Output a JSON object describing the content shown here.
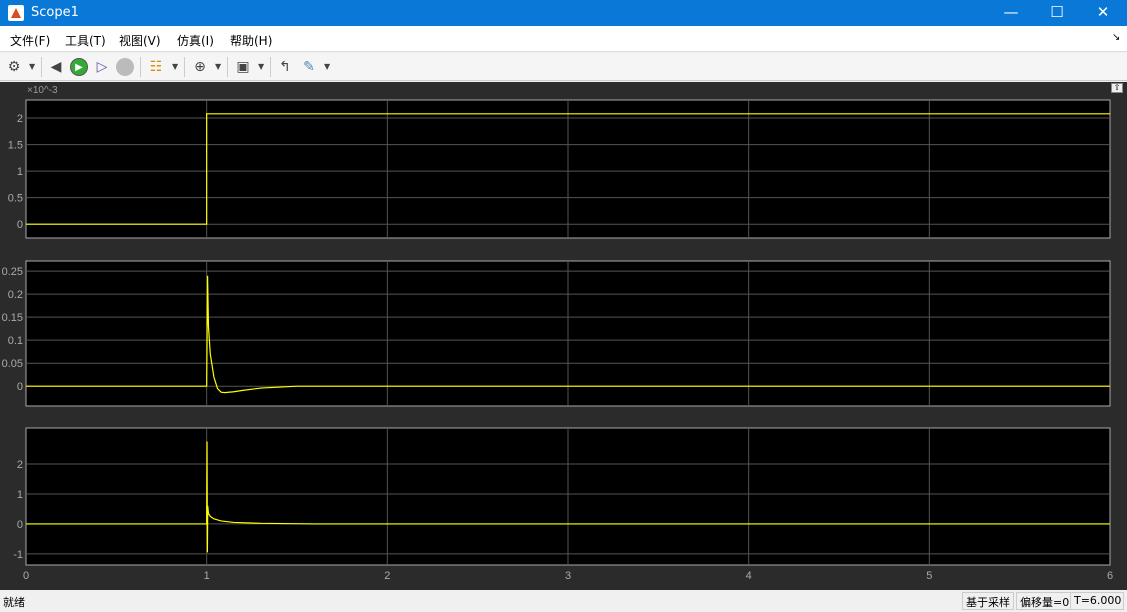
{
  "window": {
    "title": "Scope1"
  },
  "menu": [
    "文件(F)",
    "工具(T)",
    "视图(V)",
    "仿真(I)",
    "帮助(H)"
  ],
  "toolbar": [
    "settings-icon",
    "step-back-icon",
    "run-icon",
    "step-forward-icon",
    "stop-icon",
    "signal-select-icon",
    "zoom-in-icon",
    "autoscale-icon",
    "triggers-icon",
    "measurements-icon"
  ],
  "status": {
    "left": "就绪",
    "mode": "基于采样",
    "offset": "偏移量=0",
    "time": "T=6.000"
  },
  "chart_data": [
    {
      "type": "line",
      "ylim": [
        -0.26,
        2.34
      ],
      "yticks": [
        "0",
        "0.5",
        "1",
        "1.5",
        "2"
      ],
      "ytick_values": [
        0,
        0.5,
        1,
        1.5,
        2
      ],
      "exponent": "×10^-3",
      "exp_base": "×10",
      "exp_pow": "-3",
      "xlim": [
        0,
        6
      ],
      "grid": true,
      "color": "#ffff00",
      "x": [
        0,
        1,
        1,
        6
      ],
      "y": [
        0,
        0,
        2.08,
        2.08
      ]
    },
    {
      "type": "line",
      "ylim": [
        -0.043,
        0.272
      ],
      "yticks": [
        "0",
        "0.05",
        "0.1",
        "0.15",
        "0.2",
        "0.25"
      ],
      "ytick_values": [
        0,
        0.05,
        0.1,
        0.15,
        0.2,
        0.25
      ],
      "xlim": [
        0,
        6
      ],
      "grid": true,
      "color": "#ffff00",
      "x": [
        0,
        1,
        1.005,
        1.01,
        1.015,
        1.02,
        1.04,
        1.06,
        1.08,
        1.1,
        1.15,
        1.2,
        1.3,
        1.5,
        2,
        6
      ],
      "y": [
        0,
        0,
        0.24,
        0.13,
        0.1,
        0.07,
        0.02,
        -0.005,
        -0.013,
        -0.014,
        -0.012,
        -0.009,
        -0.004,
        0,
        0,
        0
      ]
    },
    {
      "type": "line",
      "ylim": [
        -1.37,
        3.2
      ],
      "yticks": [
        "-1",
        "0",
        "1",
        "2"
      ],
      "ytick_values": [
        -1,
        0,
        1,
        2
      ],
      "xlim": [
        0,
        6
      ],
      "xticks": [
        "0",
        "1",
        "2",
        "3",
        "4",
        "5",
        "6"
      ],
      "xtick_values": [
        0,
        1,
        2,
        3,
        4,
        5,
        6
      ],
      "grid": true,
      "color": "#ffff00",
      "x": [
        0,
        1,
        1.002,
        1.004,
        1.006,
        1.01,
        1.02,
        1.04,
        1.08,
        1.15,
        1.3,
        1.6,
        6
      ],
      "y": [
        0,
        0,
        2.75,
        -0.95,
        0.6,
        0.35,
        0.25,
        0.17,
        0.1,
        0.05,
        0.02,
        0,
        0
      ]
    }
  ]
}
